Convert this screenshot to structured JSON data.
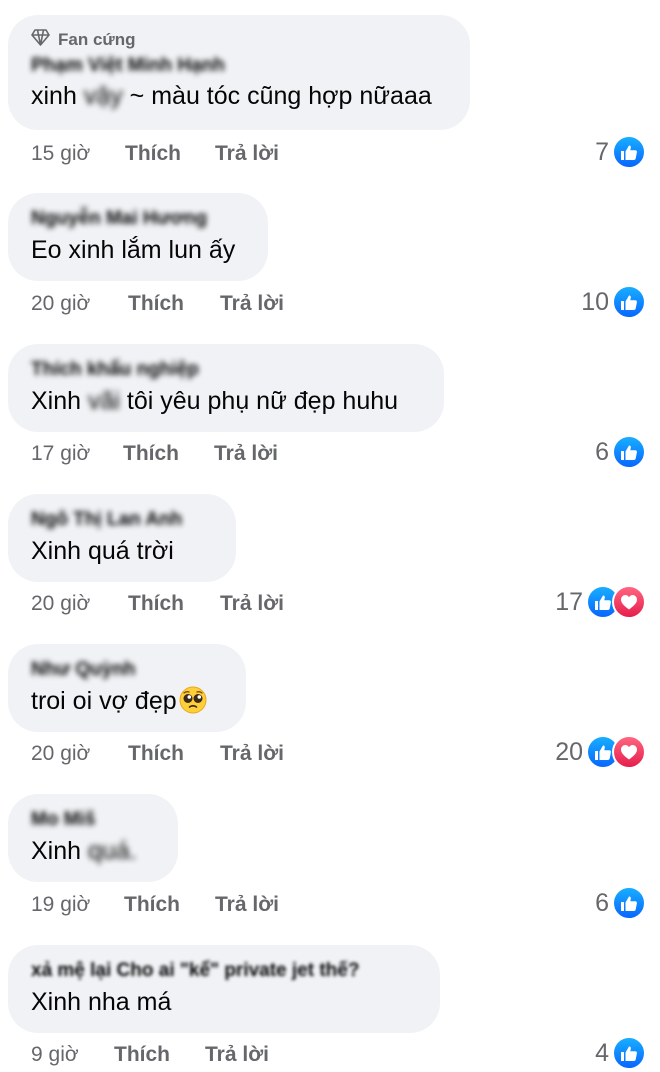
{
  "ui": {
    "like_label": "Thích",
    "reply_label": "Trả lời"
  },
  "comments": [
    {
      "badge": "Fan cứng",
      "author": "Phạm Việt Minh Hạnh",
      "text_pre": "xinh",
      "text_blur": "vậy",
      "text_post": " ~ màu tóc cũng hợp nữaaa",
      "time": "15 giờ",
      "count": "7",
      "reactions": [
        "like-icon"
      ]
    },
    {
      "author": "Nguyễn Mai Hương",
      "text_pre": "Eo xinh lắm lun ấy",
      "time": "20 giờ",
      "count": "10",
      "reactions": [
        "like-icon"
      ]
    },
    {
      "author": "Thích khẩu nghiệp",
      "text_pre": "Xinh",
      "text_blur": "vãi",
      "text_post": " tôi yêu phụ nữ đẹp huhu",
      "time": "17 giờ",
      "count": "6",
      "reactions": [
        "like-icon"
      ]
    },
    {
      "author": "Ngô Thị Lan Anh",
      "text_pre": "Xinh quá trời",
      "time": "20 giờ",
      "count": "17",
      "reactions": [
        "like-icon",
        "love-icon"
      ]
    },
    {
      "author": "Như Quỳnh",
      "text_pre": "troi oi vợ đẹp",
      "emoji": "pleading-face-emoji",
      "time": "20 giờ",
      "count": "20",
      "reactions": [
        "like-icon",
        "love-icon"
      ]
    },
    {
      "author": "Mo Miš",
      "text_pre": "Xinh",
      "text_blur": "quá.",
      "time": "19 giờ",
      "count": "6",
      "reactions": [
        "like-icon"
      ]
    },
    {
      "author": "xả mệ lại Cho ai \"kể\" private jet thế?",
      "text_pre": "Xinh nha má",
      "time": "9 giờ",
      "count": "4",
      "reactions": [
        "like-icon"
      ]
    }
  ]
}
